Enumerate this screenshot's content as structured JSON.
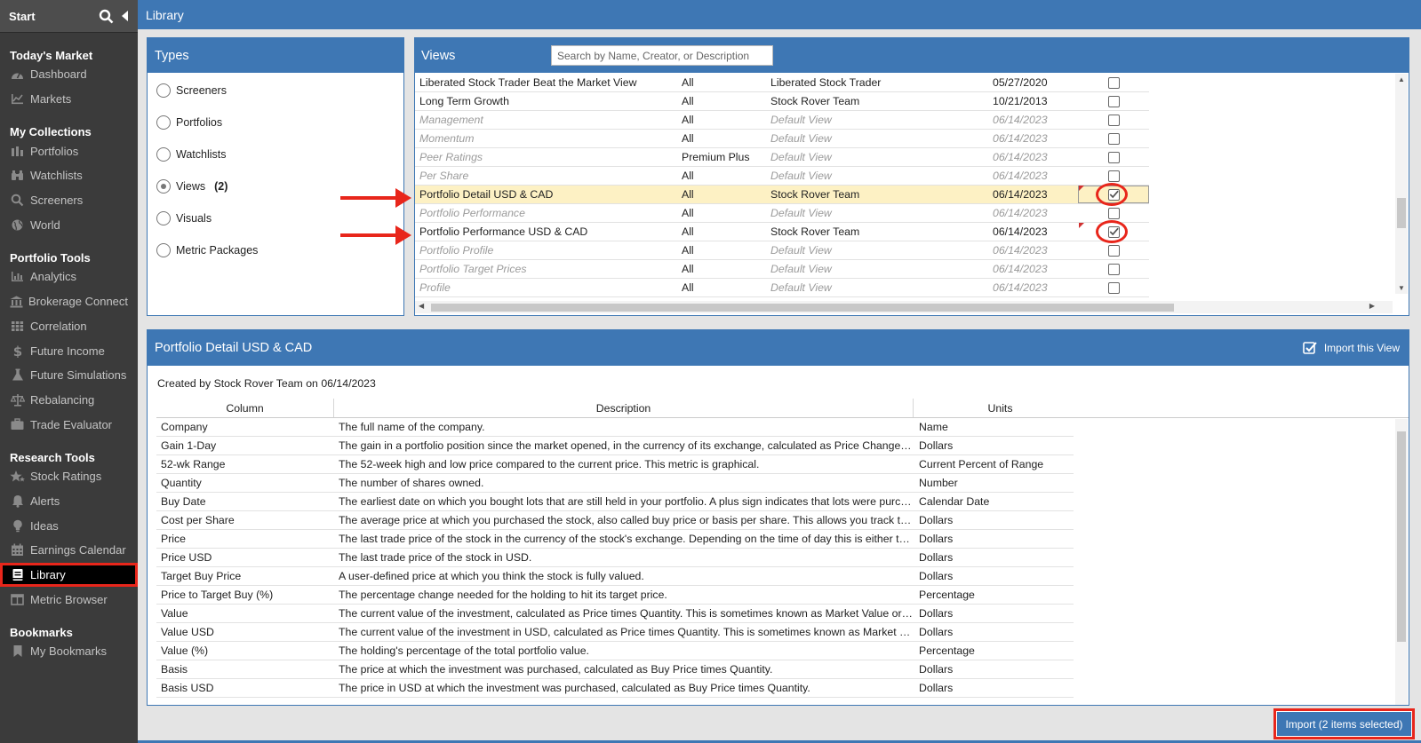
{
  "sidebar": {
    "start": "Start",
    "sections": [
      {
        "title": "Today's Market",
        "items": [
          {
            "label": "Dashboard",
            "icon": "dashboard-icon"
          },
          {
            "label": "Markets",
            "icon": "chart-icon"
          }
        ]
      },
      {
        "title": "My Collections",
        "items": [
          {
            "label": "Portfolios",
            "icon": "portfolio-icon"
          },
          {
            "label": "Watchlists",
            "icon": "binoculars-icon"
          },
          {
            "label": "Screeners",
            "icon": "search-icon"
          },
          {
            "label": "World",
            "icon": "globe-icon"
          }
        ]
      },
      {
        "title": "Portfolio Tools",
        "items": [
          {
            "label": "Analytics",
            "icon": "analytics-icon"
          },
          {
            "label": "Brokerage Connect",
            "icon": "bank-icon"
          },
          {
            "label": "Correlation",
            "icon": "grid-icon"
          },
          {
            "label": "Future Income",
            "icon": "dollar-icon"
          },
          {
            "label": "Future Simulations",
            "icon": "flask-icon"
          },
          {
            "label": "Rebalancing",
            "icon": "scale-icon"
          },
          {
            "label": "Trade Evaluator",
            "icon": "briefcase-icon"
          }
        ]
      },
      {
        "title": "Research Tools",
        "items": [
          {
            "label": "Stock Ratings",
            "icon": "stars-icon"
          },
          {
            "label": "Alerts",
            "icon": "bell-icon"
          },
          {
            "label": "Ideas",
            "icon": "lightbulb-icon"
          },
          {
            "label": "Earnings Calendar",
            "icon": "calendar-icon"
          },
          {
            "label": "Library",
            "icon": "book-icon",
            "active": true
          },
          {
            "label": "Metric Browser",
            "icon": "table-icon"
          }
        ]
      },
      {
        "title": "Bookmarks",
        "items": [
          {
            "label": "My Bookmarks",
            "icon": "bookmark-icon"
          }
        ]
      }
    ]
  },
  "topbar": {
    "title": "Library"
  },
  "types": {
    "title": "Types",
    "items": [
      {
        "label": "Screeners",
        "selected": false,
        "count": ""
      },
      {
        "label": "Portfolios",
        "selected": false,
        "count": ""
      },
      {
        "label": "Watchlists",
        "selected": false,
        "count": ""
      },
      {
        "label": "Views",
        "selected": true,
        "count": "(2)"
      },
      {
        "label": "Visuals",
        "selected": false,
        "count": ""
      },
      {
        "label": "Metric Packages",
        "selected": false,
        "count": ""
      }
    ]
  },
  "views": {
    "title": "Views",
    "search_placeholder": "Search by Name, Creator, or Description",
    "rows": [
      {
        "name": "Liberated Stock Trader Beat the Market View",
        "plan": "All",
        "creator": "Liberated Stock Trader",
        "date": "05/27/2020",
        "checked": false,
        "dim": false
      },
      {
        "name": "Long Term Growth",
        "plan": "All",
        "creator": "Stock Rover Team",
        "date": "10/21/2013",
        "checked": false,
        "dim": false
      },
      {
        "name": "Management",
        "plan": "All",
        "creator": "Default View",
        "date": "06/14/2023",
        "checked": false,
        "dim": true
      },
      {
        "name": "Momentum",
        "plan": "All",
        "creator": "Default View",
        "date": "06/14/2023",
        "checked": false,
        "dim": true
      },
      {
        "name": "Peer Ratings",
        "plan": "Premium Plus",
        "creator": "Default View",
        "date": "06/14/2023",
        "checked": false,
        "dim": true
      },
      {
        "name": "Per Share",
        "plan": "All",
        "creator": "Default View",
        "date": "06/14/2023",
        "checked": false,
        "dim": true
      },
      {
        "name": "Portfolio Detail USD & CAD",
        "plan": "All",
        "creator": "Stock Rover Team",
        "date": "06/14/2023",
        "checked": true,
        "dim": false,
        "highlight": true
      },
      {
        "name": "Portfolio Performance",
        "plan": "All",
        "creator": "Default View",
        "date": "06/14/2023",
        "checked": false,
        "dim": true
      },
      {
        "name": "Portfolio Performance USD & CAD",
        "plan": "All",
        "creator": "Stock Rover Team",
        "date": "06/14/2023",
        "checked": true,
        "dim": false
      },
      {
        "name": "Portfolio Profile",
        "plan": "All",
        "creator": "Default View",
        "date": "06/14/2023",
        "checked": false,
        "dim": true
      },
      {
        "name": "Portfolio Target Prices",
        "plan": "All",
        "creator": "Default View",
        "date": "06/14/2023",
        "checked": false,
        "dim": true
      },
      {
        "name": "Profile",
        "plan": "All",
        "creator": "Default View",
        "date": "06/14/2023",
        "checked": false,
        "dim": true
      }
    ]
  },
  "detail": {
    "title": "Portfolio Detail USD & CAD",
    "import_view_label": "Import this View",
    "created": "Created by Stock Rover Team on 06/14/2023",
    "headers": [
      "Column",
      "Description",
      "Units"
    ],
    "rows": [
      [
        "Company",
        "The full name of the company.",
        "Name"
      ],
      [
        "Gain 1-Day",
        "The gain in a portfolio position since the market opened, in the currency of its exchange, calculated as Price Change (...",
        "Dollars"
      ],
      [
        "52-wk Range",
        "The 52-week high and low price compared to the current price. This metric is graphical.",
        "Current Percent of Range"
      ],
      [
        "Quantity",
        "The number of shares owned.",
        "Number"
      ],
      [
        "Buy Date",
        "The earliest date on which you bought lots that are still held in your portfolio. A plus sign indicates that lots were purch...",
        "Calendar Date"
      ],
      [
        "Cost per Share",
        "The average price at which you purchased the stock, also called buy price or basis per share. This allows you track th...",
        "Dollars"
      ],
      [
        "Price",
        "The last trade price of the stock in the currency of the stock's exchange. Depending on the time of day this is either th...",
        "Dollars"
      ],
      [
        "Price USD",
        "The last trade price of the stock in USD.",
        "Dollars"
      ],
      [
        "Target Buy Price",
        "A user-defined price at which you think the stock is fully valued.",
        "Dollars"
      ],
      [
        "Price to Target Buy (%)",
        "The percentage change needed for the holding to hit its target price.",
        "Percentage"
      ],
      [
        "Value",
        "The current value of the investment, calculated as Price times Quantity. This is sometimes known as Market Value or ...",
        "Dollars"
      ],
      [
        "Value USD",
        "The current value of the investment in USD, calculated as Price times Quantity. This is sometimes known as Market V...",
        "Dollars"
      ],
      [
        "Value (%)",
        "The holding's percentage of the total portfolio value.",
        "Percentage"
      ],
      [
        "Basis",
        "The price at which the investment was purchased, calculated as Buy Price times Quantity.",
        "Dollars"
      ],
      [
        "Basis USD",
        "The price in USD at which the investment was purchased, calculated as Buy Price times Quantity.",
        "Dollars"
      ]
    ]
  },
  "import_button": "Import (2 items selected)",
  "colors": {
    "accent": "#3e77b4",
    "annotation_red": "#e8261b",
    "sidebar_bg": "#3b3b3b",
    "highlight_row": "#fdf1c4"
  }
}
